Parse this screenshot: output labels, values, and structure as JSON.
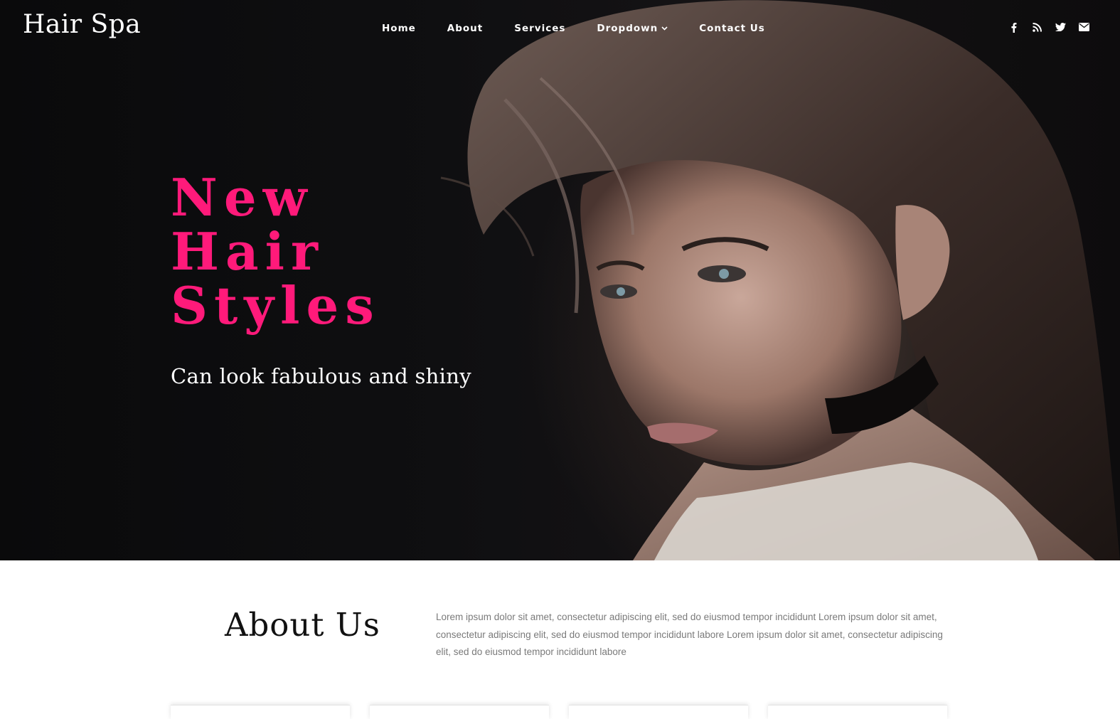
{
  "brand": "Hair Spa",
  "nav": {
    "items": [
      {
        "label": "Home"
      },
      {
        "label": "About"
      },
      {
        "label": "Services"
      },
      {
        "label": "Dropdown",
        "chevron": "chevron-down-icon"
      },
      {
        "label": "Contact Us"
      }
    ]
  },
  "social": {
    "icons": [
      "facebook-icon",
      "rss-icon",
      "twitter-icon",
      "envelope-icon"
    ]
  },
  "hero": {
    "title_lines": [
      "New",
      "Hair",
      "Styles"
    ],
    "subtitle": "Can look fabulous and shiny",
    "accent_color": "#ff1a7a"
  },
  "about": {
    "title": "About Us",
    "text": "Lorem ipsum dolor sit amet, consectetur adipiscing elit, sed do eiusmod tempor incididunt Lorem ipsum dolor sit amet, consectetur adipiscing elit, sed do eiusmod tempor incididunt labore Lorem ipsum dolor sit amet, consectetur adipiscing elit, sed do eiusmod tempor incididunt labore"
  }
}
